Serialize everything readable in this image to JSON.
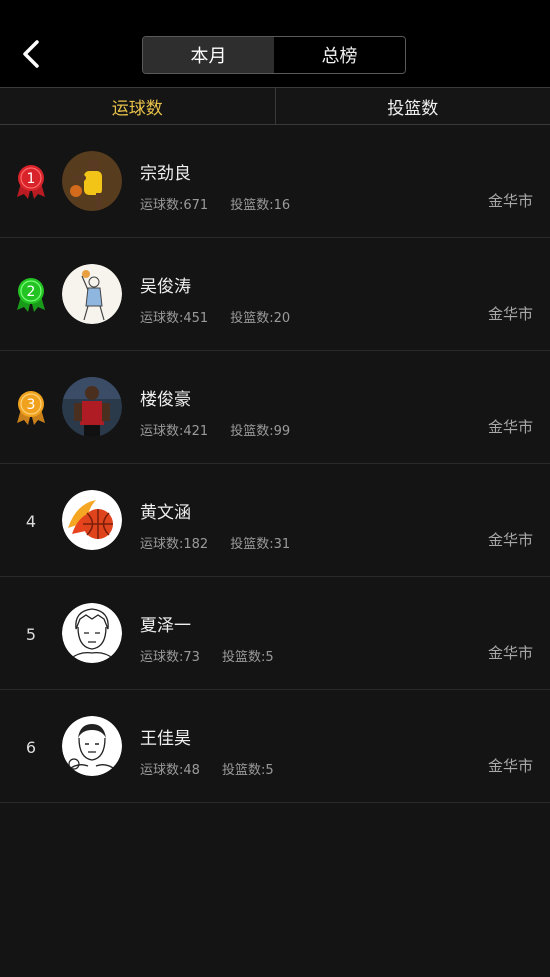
{
  "header": {
    "segments": [
      "本月",
      "总榜"
    ],
    "active_segment": "本月"
  },
  "tabs": [
    "运球数",
    "投篮数"
  ],
  "active_tab": "运球数",
  "colors": {
    "active_tab": "#e8c14a",
    "rank1": "#d8232a",
    "rank2": "#22c322",
    "rank3": "#f0a21e"
  },
  "rows": [
    {
      "rank": "1",
      "name": "宗劲良",
      "dribble": "运球数:671",
      "shot": "投篮数:16",
      "city": "金华市"
    },
    {
      "rank": "2",
      "name": "吴俊涛",
      "dribble": "运球数:451",
      "shot": "投篮数:20",
      "city": "金华市"
    },
    {
      "rank": "3",
      "name": "楼俊豪",
      "dribble": "运球数:421",
      "shot": "投篮数:99",
      "city": "金华市"
    },
    {
      "rank": "4",
      "name": "黄文涵",
      "dribble": "运球数:182",
      "shot": "投篮数:31",
      "city": "金华市"
    },
    {
      "rank": "5",
      "name": "夏泽一",
      "dribble": "运球数:73",
      "shot": "投篮数:5",
      "city": "金华市"
    },
    {
      "rank": "6",
      "name": "王佳昊",
      "dribble": "运球数:48",
      "shot": "投篮数:5",
      "city": "金华市"
    }
  ]
}
